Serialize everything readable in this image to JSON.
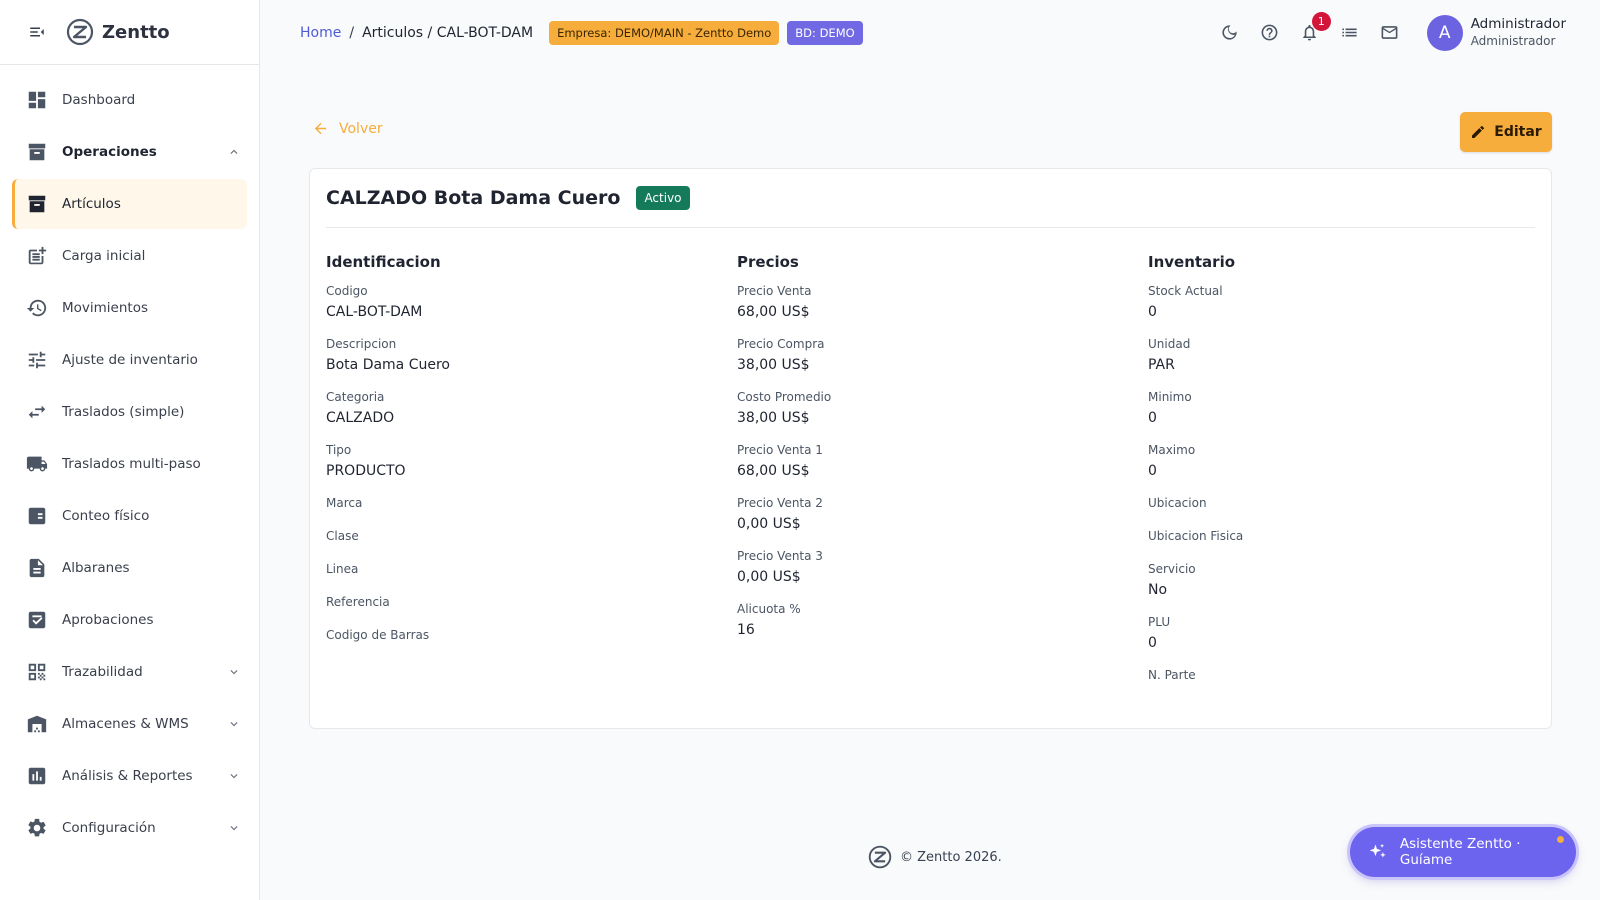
{
  "app": {
    "brand": "Zentto"
  },
  "sidebar": {
    "items": [
      {
        "label": "Dashboard",
        "icon": "dashboard-icon"
      },
      {
        "label": "Operaciones",
        "icon": "archive-icon",
        "expanded": true
      },
      {
        "label": "Artículos",
        "icon": "archive-icon",
        "active": true
      },
      {
        "label": "Carga inicial",
        "icon": "post-add-icon"
      },
      {
        "label": "Movimientos",
        "icon": "history-icon"
      },
      {
        "label": "Ajuste de inventario",
        "icon": "tune-icon"
      },
      {
        "label": "Traslados (simple)",
        "icon": "swap-icon"
      },
      {
        "label": "Traslados multi-paso",
        "icon": "truck-icon"
      },
      {
        "label": "Conteo físico",
        "icon": "checklist-icon"
      },
      {
        "label": "Albaranes",
        "icon": "document-icon"
      },
      {
        "label": "Aprobaciones",
        "icon": "approval-icon"
      },
      {
        "label": "Trazabilidad",
        "icon": "qr-code-icon",
        "collapsible": true
      },
      {
        "label": "Almacenes & WMS",
        "icon": "warehouse-icon",
        "collapsible": true
      },
      {
        "label": "Análisis & Reportes",
        "icon": "bar-chart-icon",
        "collapsible": true
      },
      {
        "label": "Configuración",
        "icon": "gear-icon",
        "collapsible": true
      }
    ]
  },
  "header": {
    "breadcrumb_home": "Home",
    "breadcrumb_sep": "/",
    "breadcrumb_current": "Articulos / CAL-BOT-DAM",
    "company_chip": "Empresa: DEMO/MAIN - Zentto Demo",
    "db_chip": "BD: DEMO",
    "notification_count": "1",
    "user_name": "Administrador",
    "user_role": "Administrador",
    "avatar_initial": "A"
  },
  "page": {
    "back_label": "Volver",
    "edit_label": "Editar",
    "title": "CALZADO Bota Dama Cuero",
    "status": "Activo"
  },
  "sections": {
    "identificacion": {
      "title": "Identificacion",
      "fields": [
        {
          "label": "Codigo",
          "value": "CAL-BOT-DAM"
        },
        {
          "label": "Descripcion",
          "value": "Bota Dama Cuero"
        },
        {
          "label": "Categoria",
          "value": "CALZADO"
        },
        {
          "label": "Tipo",
          "value": "PRODUCTO"
        },
        {
          "label": "Marca",
          "value": ""
        },
        {
          "label": "Clase",
          "value": ""
        },
        {
          "label": "Linea",
          "value": ""
        },
        {
          "label": "Referencia",
          "value": ""
        },
        {
          "label": "Codigo de Barras",
          "value": ""
        }
      ]
    },
    "precios": {
      "title": "Precios",
      "fields": [
        {
          "label": "Precio Venta",
          "value": "68,00 US$"
        },
        {
          "label": "Precio Compra",
          "value": "38,00 US$"
        },
        {
          "label": "Costo Promedio",
          "value": "38,00 US$"
        },
        {
          "label": "Precio Venta 1",
          "value": "68,00 US$"
        },
        {
          "label": "Precio Venta 2",
          "value": "0,00 US$"
        },
        {
          "label": "Precio Venta 3",
          "value": "0,00 US$"
        },
        {
          "label": "Alicuota %",
          "value": "16"
        }
      ]
    },
    "inventario": {
      "title": "Inventario",
      "fields": [
        {
          "label": "Stock Actual",
          "value": "0"
        },
        {
          "label": "Unidad",
          "value": "PAR"
        },
        {
          "label": "Minimo",
          "value": "0"
        },
        {
          "label": "Maximo",
          "value": "0"
        },
        {
          "label": "Ubicacion",
          "value": ""
        },
        {
          "label": "Ubicacion Fisica",
          "value": ""
        },
        {
          "label": "Servicio",
          "value": "No"
        },
        {
          "label": "PLU",
          "value": "0"
        },
        {
          "label": "N. Parte",
          "value": ""
        }
      ]
    }
  },
  "footer": {
    "copyright": "© Zentto 2026."
  },
  "assistant": {
    "label": "Asistente Zentto · Guíame"
  },
  "colors": {
    "accent": "#f6ad3b",
    "primary": "#6c63ee",
    "status_active": "#147a5a",
    "link": "#4f5bd5"
  }
}
